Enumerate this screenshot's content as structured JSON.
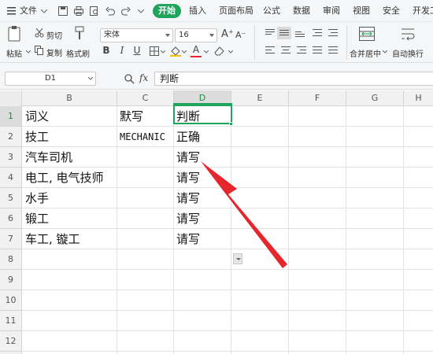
{
  "menubar": {
    "file": "文件",
    "tabs": [
      "开始",
      "插入",
      "页面布局",
      "公式",
      "数据",
      "审阅",
      "视图",
      "安全",
      "开发工"
    ]
  },
  "ribbon": {
    "paste": "粘贴",
    "cut": "剪切",
    "copy": "复制",
    "format_painter": "格式刷",
    "font_name": "宋体",
    "font_size": "16",
    "merge_center": "合并居中",
    "wrap_text": "自动换行"
  },
  "formula_bar": {
    "cell_ref": "D1",
    "fx": "fx",
    "content": "判断"
  },
  "columns": [
    "B",
    "C",
    "D",
    "E",
    "F",
    "G",
    "H"
  ],
  "rows": [
    "1",
    "2",
    "3",
    "4",
    "5",
    "6",
    "7",
    "8",
    "9",
    "10",
    "11",
    "12"
  ],
  "table": [
    {
      "b": "词义",
      "c": "默写",
      "d": "判断"
    },
    {
      "b": "技工",
      "c": "MECHANIC",
      "d": "正确"
    },
    {
      "b": "汽车司机",
      "c": "",
      "d": "请写"
    },
    {
      "b": "电工, 电气技师",
      "c": "",
      "d": "请写"
    },
    {
      "b": "水手",
      "c": "",
      "d": "请写"
    },
    {
      "b": "锻工",
      "c": "",
      "d": "请写"
    },
    {
      "b": "车工, 镟工",
      "c": "",
      "d": "请写"
    }
  ],
  "colors": {
    "accent": "#20a35a",
    "arrow": "#e5262c"
  }
}
